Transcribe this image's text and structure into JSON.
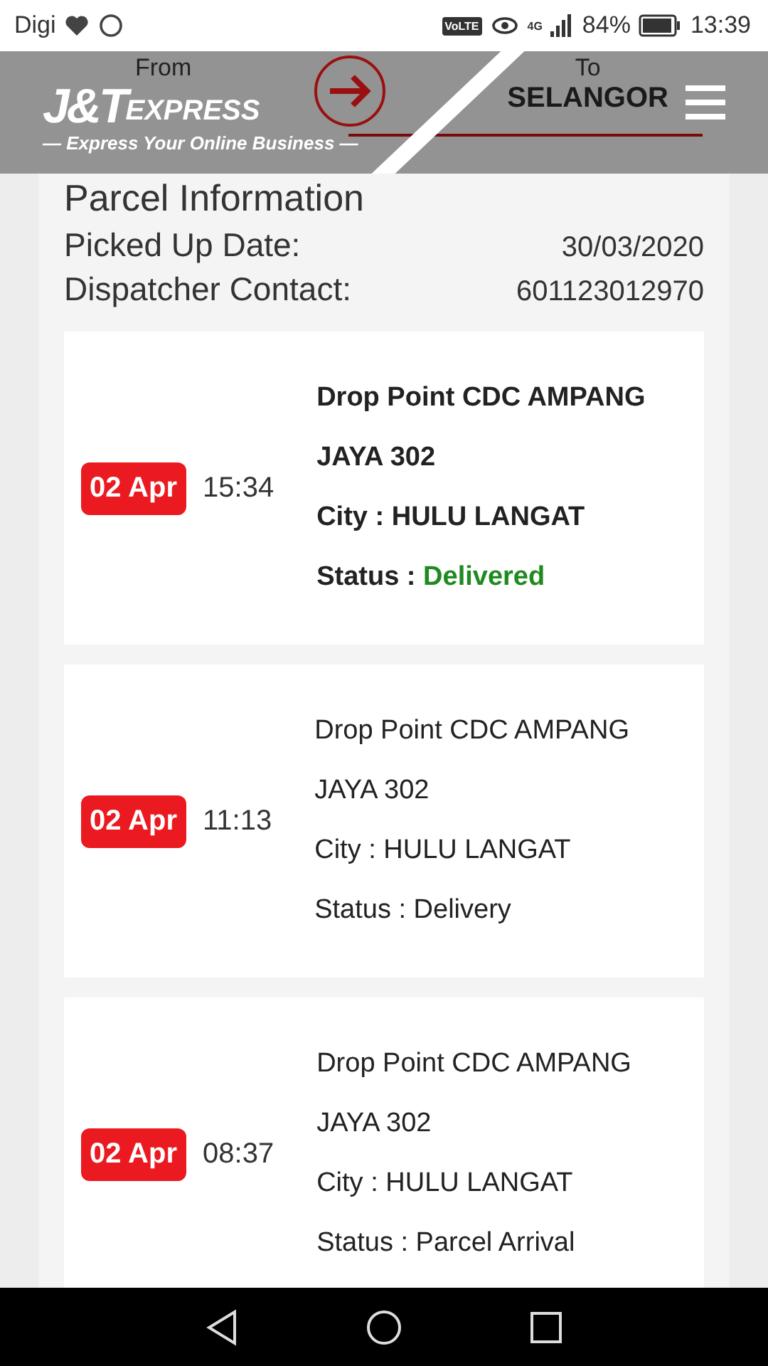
{
  "status_bar": {
    "carrier": "Digi",
    "volte": "VoLTE",
    "network": "4G",
    "battery": "84%",
    "time": "13:39"
  },
  "header": {
    "from_label": "From",
    "to_label": "To",
    "to_value": "SELANGOR",
    "logo": {
      "mark": "J&T",
      "word": "EXPRESS",
      "tagline": "— Express Your Online Business —"
    }
  },
  "parcel": {
    "title": "Parcel Information",
    "fields": [
      {
        "label": "Picked Up Date:",
        "value": "30/03/2020"
      },
      {
        "label": "Dispatcher Contact:",
        "value": "601123012970"
      }
    ]
  },
  "events": [
    {
      "date": "02 Apr",
      "time": "15:34",
      "location": "Drop Point CDC AMPANG JAYA 302",
      "city": "City : HULU LANGAT",
      "status_label": "Status : ",
      "status": "Delivered",
      "latest": true
    },
    {
      "date": "02 Apr",
      "time": "11:13",
      "location": "Drop Point CDC AMPANG JAYA 302",
      "city": "City : HULU LANGAT",
      "status_label": "Status : ",
      "status": "Delivery",
      "latest": false
    },
    {
      "date": "02 Apr",
      "time": "08:37",
      "location": "Drop Point CDC AMPANG JAYA 302",
      "city": "City : HULU LANGAT",
      "status_label": "Status : ",
      "status": "Parcel Arrival",
      "latest": false
    }
  ]
}
